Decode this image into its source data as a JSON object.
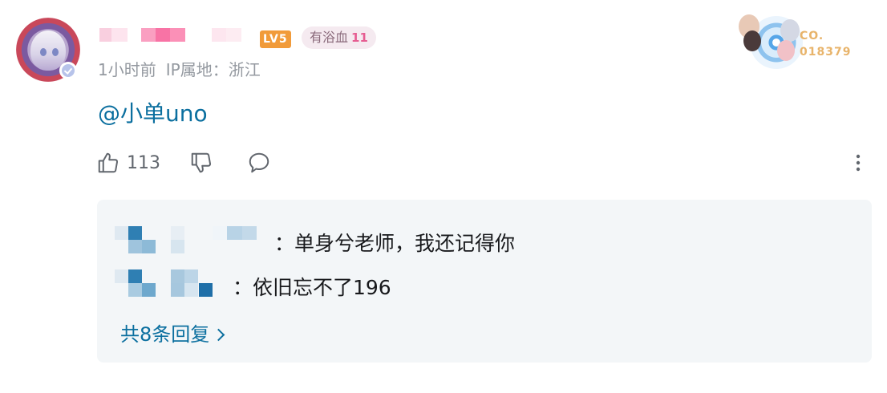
{
  "comment": {
    "level_badge": "LV5",
    "fan_medal": {
      "name": "有浴血",
      "level": "11"
    },
    "time": "1小时前",
    "ip_location": "IP属地：浙江",
    "content": "@小单uno",
    "likes": "113",
    "fan_badge_text": [
      "CO.",
      "018379"
    ]
  },
  "replies": {
    "items": [
      {
        "text": "：单身兮老师，我还记得你"
      },
      {
        "text": "：依旧忘不了196"
      }
    ],
    "view_more": "共8条回复"
  },
  "colors": {
    "link": "#0b6f9f",
    "meta": "#9499a0",
    "reply_bg": "#f3f6f8",
    "level": "#f19b3a",
    "medal_level": "#e65d92"
  },
  "icons": [
    "avatar",
    "verified-badge-icon",
    "thumb-up-icon",
    "thumb-down-icon",
    "comment-bubble-icon",
    "more-vertical-icon",
    "chevron-right-icon"
  ]
}
